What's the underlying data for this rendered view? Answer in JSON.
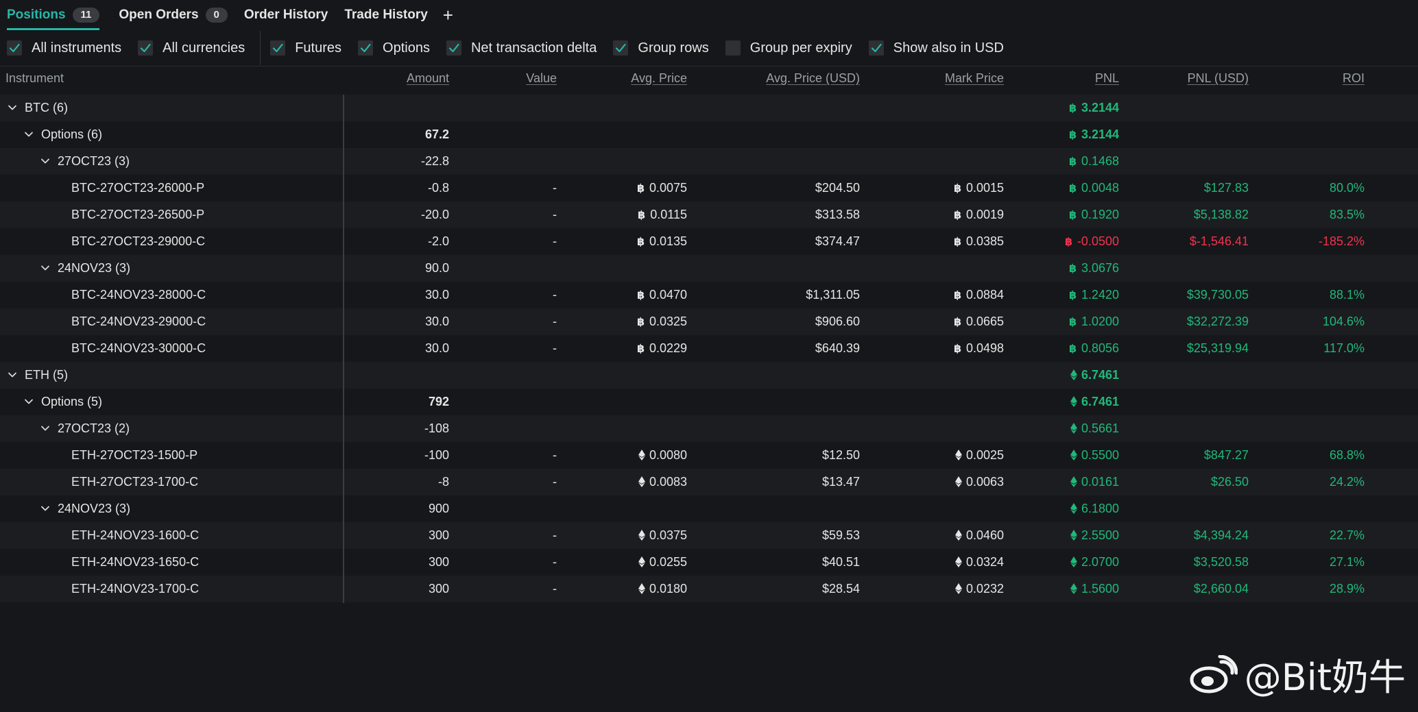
{
  "tabs": [
    {
      "label": "Positions",
      "badge": "11",
      "active": true
    },
    {
      "label": "Open Orders",
      "badge": "0"
    },
    {
      "label": "Order History"
    },
    {
      "label": "Trade History"
    }
  ],
  "add_tab_label": "+",
  "filters": [
    {
      "label": "All instruments",
      "checked": true
    },
    {
      "label": "All currencies",
      "checked": true
    },
    {
      "label": "Futures",
      "checked": true
    },
    {
      "label": "Options",
      "checked": true
    },
    {
      "label": "Net transaction delta",
      "checked": true
    },
    {
      "label": "Group rows",
      "checked": true
    },
    {
      "label": "Group per expiry",
      "checked": false
    },
    {
      "label": "Show also in USD",
      "checked": true
    }
  ],
  "columns": {
    "instrument": "Instrument",
    "amount": "Amount",
    "value": "Value",
    "avg_price": "Avg. Price",
    "avg_price_usd": "Avg. Price (USD)",
    "mark_price": "Mark Price",
    "pnl": "PNL",
    "pnl_usd": "PNL (USD)",
    "roi": "ROI"
  },
  "rows": [
    {
      "level": 0,
      "type": "group",
      "label": "BTC (6)",
      "coin": "btc",
      "pnl": "3.2144",
      "pnl_bold": true
    },
    {
      "level": 1,
      "type": "group",
      "label": "Options (6)",
      "coin": "btc",
      "amount": "67.2",
      "amount_bold": true,
      "pnl": "3.2144",
      "pnl_bold": true
    },
    {
      "level": 2,
      "type": "group",
      "label": "27OCT23 (3)",
      "coin": "btc",
      "amount": "-22.8",
      "pnl": "0.1468"
    },
    {
      "level": 3,
      "type": "item",
      "label": "BTC-27OCT23-26000-P",
      "coin": "btc",
      "amount": "-0.8",
      "value": "-",
      "avg_price": "0.0075",
      "avg_price_usd": "$204.50",
      "mark_price": "0.0015",
      "pnl": "0.0048",
      "pnl_usd": "$127.83",
      "roi": "80.0%"
    },
    {
      "level": 3,
      "type": "item",
      "label": "BTC-27OCT23-26500-P",
      "coin": "btc",
      "amount": "-20.0",
      "value": "-",
      "avg_price": "0.0115",
      "avg_price_usd": "$313.58",
      "mark_price": "0.0019",
      "pnl": "0.1920",
      "pnl_usd": "$5,138.82",
      "roi": "83.5%"
    },
    {
      "level": 3,
      "type": "item",
      "label": "BTC-27OCT23-29000-C",
      "coin": "btc",
      "amount": "-2.0",
      "value": "-",
      "avg_price": "0.0135",
      "avg_price_usd": "$374.47",
      "mark_price": "0.0385",
      "pnl": "-0.0500",
      "pnl_usd": "$-1,546.41",
      "roi": "-185.2%",
      "negative": true
    },
    {
      "level": 2,
      "type": "group",
      "label": "24NOV23 (3)",
      "coin": "btc",
      "amount": "90.0",
      "pnl": "3.0676"
    },
    {
      "level": 3,
      "type": "item",
      "label": "BTC-24NOV23-28000-C",
      "coin": "btc",
      "amount": "30.0",
      "value": "-",
      "avg_price": "0.0470",
      "avg_price_usd": "$1,311.05",
      "mark_price": "0.0884",
      "pnl": "1.2420",
      "pnl_usd": "$39,730.05",
      "roi": "88.1%"
    },
    {
      "level": 3,
      "type": "item",
      "label": "BTC-24NOV23-29000-C",
      "coin": "btc",
      "amount": "30.0",
      "value": "-",
      "avg_price": "0.0325",
      "avg_price_usd": "$906.60",
      "mark_price": "0.0665",
      "pnl": "1.0200",
      "pnl_usd": "$32,272.39",
      "roi": "104.6%"
    },
    {
      "level": 3,
      "type": "item",
      "label": "BTC-24NOV23-30000-C",
      "coin": "btc",
      "amount": "30.0",
      "value": "-",
      "avg_price": "0.0229",
      "avg_price_usd": "$640.39",
      "mark_price": "0.0498",
      "pnl": "0.8056",
      "pnl_usd": "$25,319.94",
      "roi": "117.0%"
    },
    {
      "level": 0,
      "type": "group",
      "label": "ETH (5)",
      "coin": "eth",
      "pnl": "6.7461",
      "pnl_bold": true
    },
    {
      "level": 1,
      "type": "group",
      "label": "Options (5)",
      "coin": "eth",
      "amount": "792",
      "amount_bold": true,
      "pnl": "6.7461",
      "pnl_bold": true
    },
    {
      "level": 2,
      "type": "group",
      "label": "27OCT23 (2)",
      "coin": "eth",
      "amount": "-108",
      "pnl": "0.5661"
    },
    {
      "level": 3,
      "type": "item",
      "label": "ETH-27OCT23-1500-P",
      "coin": "eth",
      "amount": "-100",
      "value": "-",
      "avg_price": "0.0080",
      "avg_price_usd": "$12.50",
      "mark_price": "0.0025",
      "pnl": "0.5500",
      "pnl_usd": "$847.27",
      "roi": "68.8%"
    },
    {
      "level": 3,
      "type": "item",
      "label": "ETH-27OCT23-1700-C",
      "coin": "eth",
      "amount": "-8",
      "value": "-",
      "avg_price": "0.0083",
      "avg_price_usd": "$13.47",
      "mark_price": "0.0063",
      "pnl": "0.0161",
      "pnl_usd": "$26.50",
      "roi": "24.2%"
    },
    {
      "level": 2,
      "type": "group",
      "label": "24NOV23 (3)",
      "coin": "eth",
      "amount": "900",
      "pnl": "6.1800"
    },
    {
      "level": 3,
      "type": "item",
      "label": "ETH-24NOV23-1600-C",
      "coin": "eth",
      "amount": "300",
      "value": "-",
      "avg_price": "0.0375",
      "avg_price_usd": "$59.53",
      "mark_price": "0.0460",
      "pnl": "2.5500",
      "pnl_usd": "$4,394.24",
      "roi": "22.7%"
    },
    {
      "level": 3,
      "type": "item",
      "label": "ETH-24NOV23-1650-C",
      "coin": "eth",
      "amount": "300",
      "value": "-",
      "avg_price": "0.0255",
      "avg_price_usd": "$40.51",
      "mark_price": "0.0324",
      "pnl": "2.0700",
      "pnl_usd": "$3,520.58",
      "roi": "27.1%"
    },
    {
      "level": 3,
      "type": "item",
      "label": "ETH-24NOV23-1700-C",
      "coin": "eth",
      "amount": "300",
      "value": "-",
      "avg_price": "0.0180",
      "avg_price_usd": "$28.54",
      "mark_price": "0.0232",
      "pnl": "1.5600",
      "pnl_usd": "$2,660.04",
      "roi": "28.9%"
    }
  ],
  "colors": {
    "accent": "#26b8a9",
    "positive": "#21b87a",
    "negative": "#f0334d"
  },
  "icons": {
    "btc": "bitcoin-icon",
    "eth": "ethereum-icon",
    "expand": "chevron-down-icon",
    "checkbox": "check-icon"
  },
  "watermark": {
    "text": "@Bit奶牛",
    "icon": "weibo-icon"
  }
}
